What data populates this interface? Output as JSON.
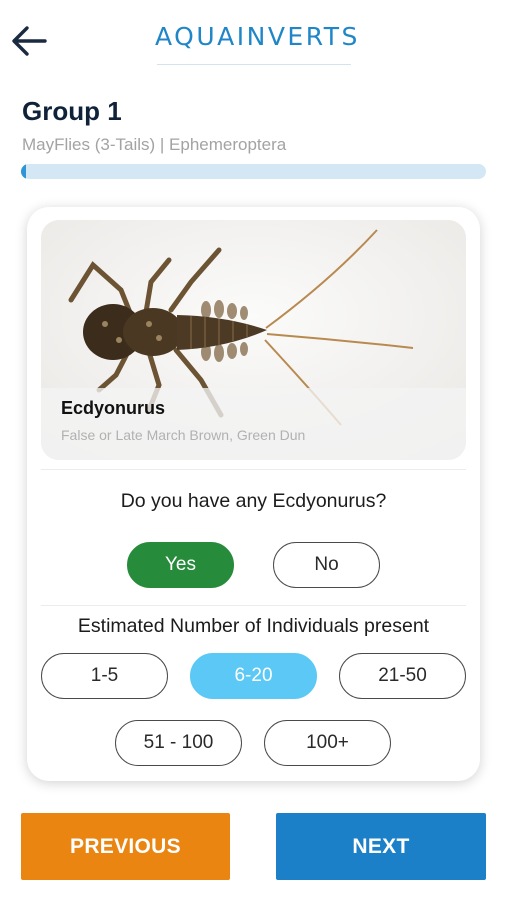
{
  "header": {
    "brand": "AQUAINVERTS",
    "back_icon": "arrow-left-icon"
  },
  "group": {
    "title": "Group 1",
    "subtitle": "MayFlies (3-Tails) | Ephemeroptera",
    "progress_fraction": 0.01
  },
  "species": {
    "name": "Ecdyonurus",
    "common_names": "False or Late March Brown, Green Dun",
    "photo_icon": "mayfly-nymph-photo"
  },
  "presence": {
    "question": "Do you have any Ecdyonurus?",
    "options": [
      "Yes",
      "No"
    ],
    "selected": "Yes"
  },
  "estimate": {
    "label": "Estimated Number of Individuals present",
    "options": [
      "1-5",
      "6-20",
      "21-50",
      "51 - 100",
      "100+"
    ],
    "selected": "6-20"
  },
  "navigation": {
    "previous_label": "PREVIOUS",
    "next_label": "NEXT"
  },
  "colors": {
    "brand": "#1f86c8",
    "yes": "#268b3a",
    "selected_estimate": "#5bc8f5",
    "previous": "#ea8512",
    "next": "#1c80c9"
  }
}
